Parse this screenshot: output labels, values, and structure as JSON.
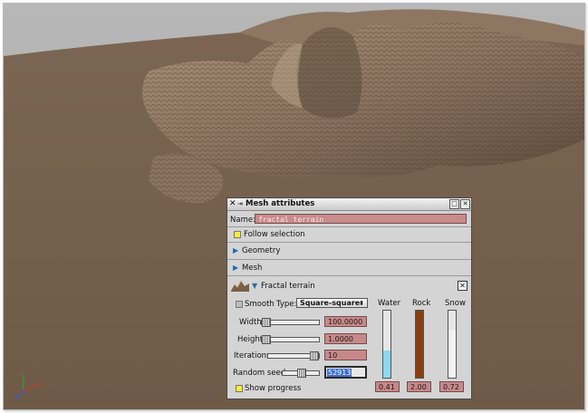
{
  "dialog": {
    "title": "Mesh attributes",
    "name_label": "Name:",
    "name_value": "fractal terrain",
    "follow_selection_label": "Follow selection",
    "sections": {
      "geometry": "Geometry",
      "mesh": "Mesh",
      "fractal": "Fractal terrain"
    },
    "smooth_label": "Smooth",
    "type_label": "Type:",
    "type_value": "Square-square",
    "width_label": "Width",
    "width_value": "100.0000",
    "height_label": "Height",
    "height_value": "1.0000",
    "iterations_label": "Iterations",
    "iterations_value": "10",
    "seed_label": "Random seed",
    "seed_value": "52913",
    "show_progress_label": "Show progress",
    "water_label": "Water",
    "rock_label": "Rock",
    "snow_label": "Snow",
    "water_value": "0.41",
    "rock_value": "2.00",
    "snow_value": "0.72",
    "levels": {
      "water": 0.41,
      "rock": 1.0,
      "snow": 0.72
    },
    "colors": {
      "water": "#8fd7ee",
      "rock": "#8a3e10",
      "snow": "#f2f2f2",
      "field": "#c98a8a"
    }
  }
}
